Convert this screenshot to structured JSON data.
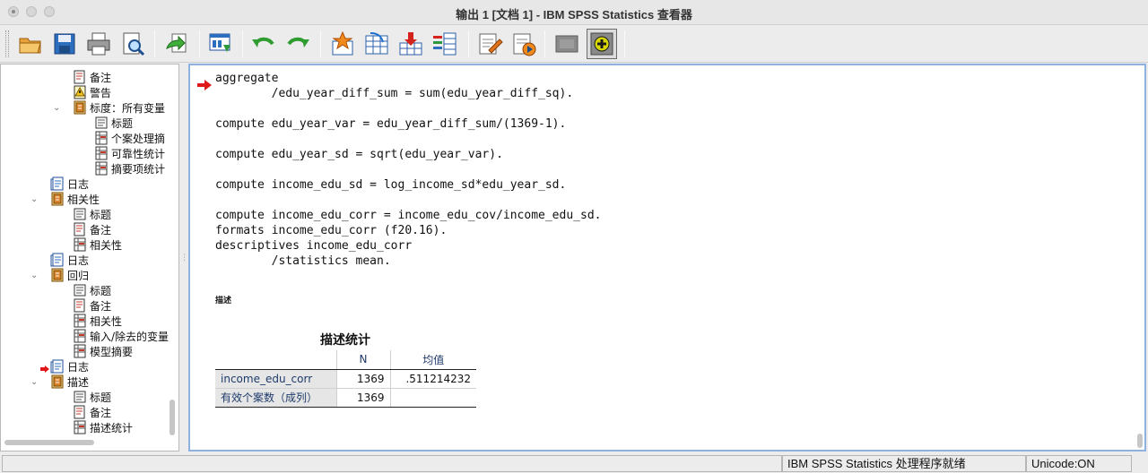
{
  "window": {
    "title": "输出 1 [文档 1] - IBM SPSS Statistics 查看器"
  },
  "toolbar": {
    "icons": [
      "open-icon",
      "save-icon",
      "print-icon",
      "print-preview-icon",
      "export-icon",
      "recall-dialog-icon",
      "undo-icon",
      "redo-icon",
      "goto-data-icon",
      "goto-case-icon",
      "goto-variable-icon",
      "variables-icon",
      "insert-heading-icon",
      "insert-title-icon",
      "hide-icon",
      "show-icon"
    ]
  },
  "tree": {
    "items": [
      {
        "label": "备注",
        "icon": "notes-icon"
      },
      {
        "label": "警告",
        "icon": "warning-icon"
      },
      {
        "label": "标度：所有变量",
        "icon": "book-icon"
      },
      {
        "label": "标题",
        "icon": "title-icon"
      },
      {
        "label": "个案处理摘",
        "icon": "table-icon"
      },
      {
        "label": "可靠性统计",
        "icon": "table-icon"
      },
      {
        "label": "摘要项统计",
        "icon": "table-icon"
      },
      {
        "label": "日志",
        "icon": "log-icon"
      },
      {
        "label": "相关性",
        "icon": "book-icon"
      },
      {
        "label": "标题",
        "icon": "title-icon"
      },
      {
        "label": "备注",
        "icon": "notes-icon"
      },
      {
        "label": "相关性",
        "icon": "table-icon"
      },
      {
        "label": "日志",
        "icon": "log-icon"
      },
      {
        "label": "回归",
        "icon": "book-icon"
      },
      {
        "label": "标题",
        "icon": "title-icon"
      },
      {
        "label": "备注",
        "icon": "notes-icon"
      },
      {
        "label": "相关性",
        "icon": "table-icon"
      },
      {
        "label": "输入/除去的变量",
        "icon": "table-icon"
      },
      {
        "label": "模型摘要",
        "icon": "table-icon"
      },
      {
        "label": "日志",
        "icon": "log-icon"
      },
      {
        "label": "描述",
        "icon": "book-icon"
      },
      {
        "label": "标题",
        "icon": "title-icon"
      },
      {
        "label": "备注",
        "icon": "notes-icon"
      },
      {
        "label": "描述统计",
        "icon": "table-icon"
      }
    ]
  },
  "content": {
    "syntax": [
      "aggregate",
      "        /edu_year_diff_sum = sum(edu_year_diff_sq).",
      "",
      "compute edu_year_var = edu_year_diff_sum/(1369-1).",
      "",
      "compute edu_year_sd = sqrt(edu_year_var).",
      "",
      "compute income_edu_sd = log_income_sd*edu_year_sd.",
      "",
      "compute income_edu_corr = income_edu_cov/income_edu_sd.",
      "formats income_edu_corr (f20.16).",
      "descriptives income_edu_corr",
      "        /statistics mean."
    ],
    "section_title": "描述",
    "table": {
      "title": "描述统计",
      "columns": [
        "",
        "N",
        "均值"
      ],
      "rows": [
        [
          "income_edu_corr",
          "1369",
          ".511214232"
        ],
        [
          "有效个案数（成列）",
          "1369",
          ""
        ]
      ]
    }
  },
  "status": {
    "processor": "IBM SPSS Statistics 处理程序就绪",
    "unicode": "Unicode:ON"
  },
  "colors": {
    "selection_border": "#8fb1e0",
    "row_label_bg": "#e6e6e6",
    "header_text": "#1f3b6b",
    "marker": "#e01818"
  }
}
